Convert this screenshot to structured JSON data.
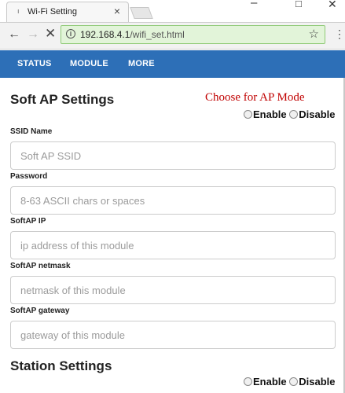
{
  "browser": {
    "tab_title": "Wi-Fi Setting",
    "tab_favicon": "ı",
    "url_host": "192.168.4.1",
    "url_path": "/wifi_set.html",
    "window_controls": {
      "minimize": "–",
      "maximize": "□",
      "close": "✕"
    },
    "icons": {
      "back": "back-arrow-icon",
      "forward": "forward-arrow-icon",
      "stop": "stop-icon",
      "info": "info-icon",
      "bookmark": "star-icon",
      "menu": "more-vert-icon"
    },
    "omnibox_color": "#e2f4d9"
  },
  "nav": {
    "items": [
      "STATUS",
      "MODULE",
      "MORE"
    ],
    "background": "#2d6fb7"
  },
  "softap": {
    "title": "Soft AP Settings",
    "hint": "Choose for AP Mode",
    "enable_label": "Enable",
    "disable_label": "Disable",
    "fields": [
      {
        "label": "SSID Name",
        "placeholder": "Soft AP SSID"
      },
      {
        "label": "Password",
        "placeholder": "8-63 ASCII chars or spaces"
      },
      {
        "label": "SoftAP IP",
        "placeholder": "ip address of this module"
      },
      {
        "label": "SoftAP netmask",
        "placeholder": "netmask of this module"
      },
      {
        "label": "SoftAP gateway",
        "placeholder": "gateway of this module"
      }
    ]
  },
  "station": {
    "title": "Station Settings",
    "enable_label": "Enable",
    "disable_label": "Disable"
  }
}
